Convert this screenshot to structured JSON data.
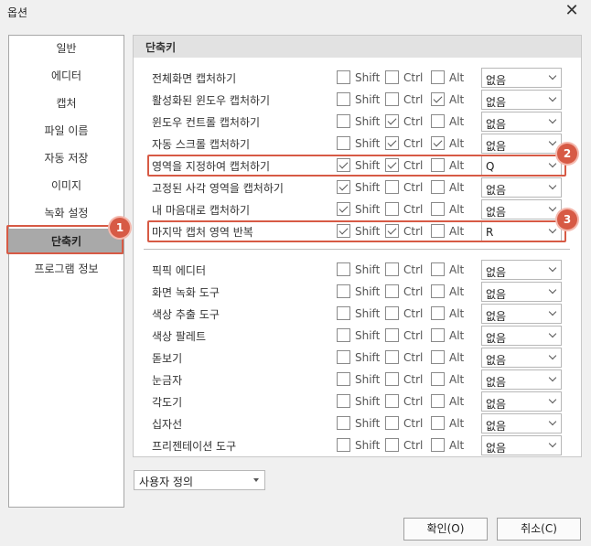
{
  "window": {
    "title": "옵션"
  },
  "sidebar": {
    "items": [
      {
        "label": "일반"
      },
      {
        "label": "에디터"
      },
      {
        "label": "캡처"
      },
      {
        "label": "파일 이름"
      },
      {
        "label": "자동 저장"
      },
      {
        "label": "이미지"
      },
      {
        "label": "녹화 설정"
      },
      {
        "label": "단축키",
        "selected": true
      },
      {
        "label": "프로그램 정보"
      }
    ]
  },
  "section": {
    "title": "단축키"
  },
  "modifiers": {
    "shift": "Shift",
    "ctrl": "Ctrl",
    "alt": "Alt"
  },
  "capture_shortcuts": [
    {
      "label": "전체화면 캡처하기",
      "shift": false,
      "ctrl": false,
      "alt": false,
      "key": "없음"
    },
    {
      "label": "활성화된 윈도우 캡처하기",
      "shift": false,
      "ctrl": false,
      "alt": true,
      "key": "없음"
    },
    {
      "label": "윈도우 컨트롤 캡처하기",
      "shift": false,
      "ctrl": true,
      "alt": false,
      "key": "없음"
    },
    {
      "label": "자동 스크롤 캡처하기",
      "shift": false,
      "ctrl": true,
      "alt": true,
      "key": "없음"
    },
    {
      "label": "영역을 지정하여 캡처하기",
      "shift": true,
      "ctrl": true,
      "alt": false,
      "key": "Q"
    },
    {
      "label": "고정된 사각 영역을 캡처하기",
      "shift": true,
      "ctrl": false,
      "alt": false,
      "key": "없음"
    },
    {
      "label": "내 마음대로 캡처하기",
      "shift": true,
      "ctrl": false,
      "alt": false,
      "key": "없음"
    },
    {
      "label": "마지막 캡처 영역 반복",
      "shift": true,
      "ctrl": true,
      "alt": false,
      "key": "R"
    }
  ],
  "tool_shortcuts": [
    {
      "label": "픽픽 에디터",
      "shift": false,
      "ctrl": false,
      "alt": false,
      "key": "없음"
    },
    {
      "label": "화면 녹화 도구",
      "shift": false,
      "ctrl": false,
      "alt": false,
      "key": "없음"
    },
    {
      "label": "색상 추출 도구",
      "shift": false,
      "ctrl": false,
      "alt": false,
      "key": "없음"
    },
    {
      "label": "색상 팔레트",
      "shift": false,
      "ctrl": false,
      "alt": false,
      "key": "없음"
    },
    {
      "label": "돋보기",
      "shift": false,
      "ctrl": false,
      "alt": false,
      "key": "없음"
    },
    {
      "label": "눈금자",
      "shift": false,
      "ctrl": false,
      "alt": false,
      "key": "없음"
    },
    {
      "label": "각도기",
      "shift": false,
      "ctrl": false,
      "alt": false,
      "key": "없음"
    },
    {
      "label": "십자선",
      "shift": false,
      "ctrl": false,
      "alt": false,
      "key": "없음"
    },
    {
      "label": "프리젠테이션 도구",
      "shift": false,
      "ctrl": false,
      "alt": false,
      "key": "없음"
    }
  ],
  "annotations": {
    "badge_1": "1",
    "badge_2": "2",
    "badge_3": "3"
  },
  "preset": {
    "value": "사용자 정의"
  },
  "buttons": {
    "ok": "확인(O)",
    "cancel": "취소(C)"
  },
  "colors": {
    "highlight": "#d75a45",
    "sidebar_selected": "#a9a9a9"
  }
}
